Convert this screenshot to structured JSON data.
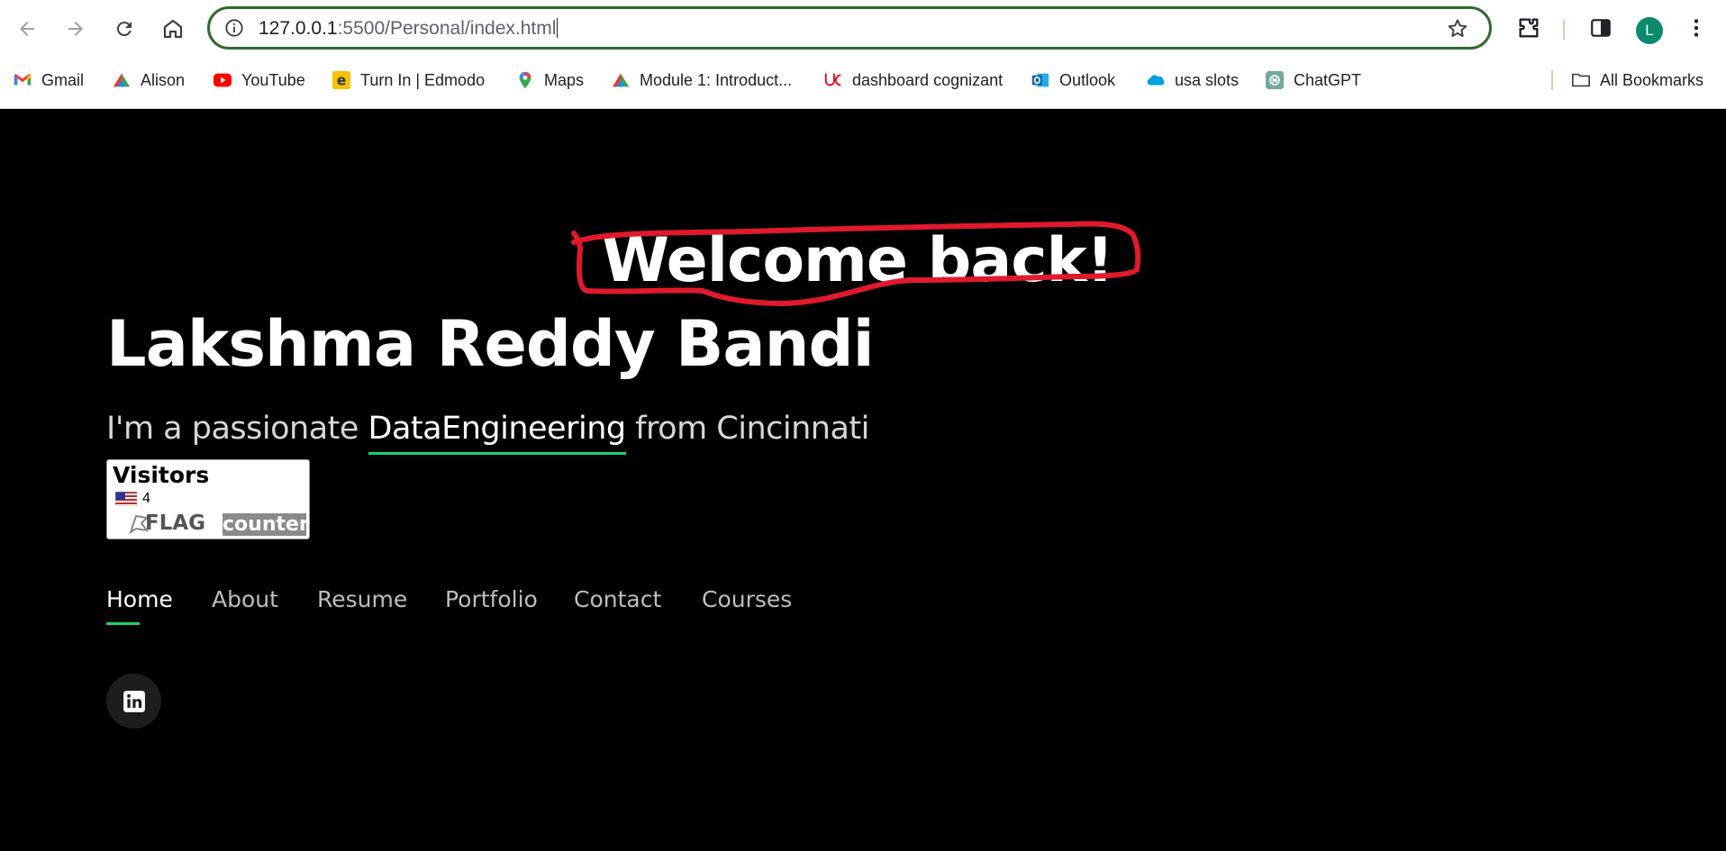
{
  "browser": {
    "url_host": "127.0.0.1",
    "url_path": ":5500/Personal/index.html",
    "profile_initial": "L",
    "bookmarks": [
      {
        "label": "Gmail",
        "icon": "gmail-icon"
      },
      {
        "label": "Alison",
        "icon": "alison-icon"
      },
      {
        "label": "YouTube",
        "icon": "youtube-icon"
      },
      {
        "label": "Turn In | Edmodo",
        "icon": "edmodo-icon"
      },
      {
        "label": "Maps",
        "icon": "maps-icon"
      },
      {
        "label": "Module 1: Introduct...",
        "icon": "alison-icon"
      },
      {
        "label": "dashboard cognizant",
        "icon": "uc-icon"
      },
      {
        "label": "Outlook",
        "icon": "outlook-icon"
      },
      {
        "label": "usa slots",
        "icon": "salesforce-icon"
      },
      {
        "label": "ChatGPT",
        "icon": "chatgpt-icon"
      }
    ],
    "all_bookmarks": "All Bookmarks",
    "colors": {
      "omnibox_border": "#2e6b2e",
      "avatar": "#0b8a6d"
    }
  },
  "page": {
    "welcome": "Welcome back!",
    "name": "Lakshma Reddy Bandi",
    "tagline_prefix": "I'm a passionate ",
    "tagline_role": "DataEngineering",
    "tagline_suffix": " from Cincinnati",
    "flag_counter": {
      "title": "Visitors",
      "count": "4",
      "brand_flag": "FLAG",
      "brand_counter": "counter"
    },
    "menu": [
      "Home",
      "About",
      "Resume",
      "Portfolio",
      "Contact",
      "Courses"
    ],
    "active_menu": "Home",
    "social_icon": "linkedin-icon",
    "colors": {
      "background": "#000000",
      "accent": "#18d26e",
      "annotation": "#e0192d"
    }
  }
}
